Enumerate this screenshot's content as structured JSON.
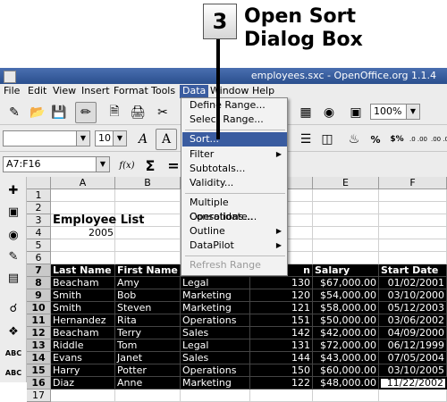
{
  "callout": {
    "number": "3",
    "line1": "Open Sort",
    "line2": "Dialog Box"
  },
  "window": {
    "title": "employees.sxc - OpenOffice.org 1.1.4"
  },
  "menubar": [
    "File",
    "Edit",
    "View",
    "Insert",
    "Format",
    "Tools",
    "Data",
    "Window",
    "Help"
  ],
  "toolbar": {
    "zoom": "100%",
    "font_size": "10",
    "italic": "A",
    "outline": "A",
    "percent": "%",
    "currency": "$%",
    "decimal_add": ".0 .00",
    "decimal_del": ".00 .0"
  },
  "formula_bar": {
    "cell_ref": "A7:F16",
    "fx": "f(x)",
    "sum": "Σ",
    "equals": "="
  },
  "data_menu": {
    "items": [
      {
        "label": "Define Range..."
      },
      {
        "label": "Select Range..."
      },
      {
        "label": "Sort..."
      },
      {
        "label": "Filter"
      },
      {
        "label": "Subtotals..."
      },
      {
        "label": "Validity..."
      },
      {
        "label": "Multiple Operations..."
      },
      {
        "label": "Consolidate..."
      },
      {
        "label": "Outline"
      },
      {
        "label": "DataPilot"
      },
      {
        "label": "Refresh Range"
      }
    ]
  },
  "sheet": {
    "columns": [
      "A",
      "B",
      "C",
      "D",
      "E",
      "F"
    ],
    "rows": [
      "1",
      "2",
      "3",
      "4",
      "5",
      "6",
      "7",
      "8",
      "9",
      "10",
      "11",
      "12",
      "13",
      "14",
      "15",
      "16",
      "17"
    ],
    "title": "Employee List",
    "year": "2005",
    "headers": [
      "Last Name",
      "First Name",
      "",
      "n",
      "Salary",
      "Start Date"
    ],
    "data": [
      [
        "Beacham",
        "Amy",
        "Legal",
        "130",
        "$67,000.00",
        "01/02/2001"
      ],
      [
        "Smith",
        "Bob",
        "Marketing",
        "120",
        "$54,000.00",
        "03/10/2000"
      ],
      [
        "Smith",
        "Steven",
        "Marketing",
        "121",
        "$58,000.00",
        "05/12/2003"
      ],
      [
        "Hernandez",
        "Rita",
        "Operations",
        "151",
        "$50,000.00",
        "03/06/2002"
      ],
      [
        "Beacham",
        "Terry",
        "Sales",
        "142",
        "$42,000.00",
        "04/09/2000"
      ],
      [
        "Riddle",
        "Tom",
        "Legal",
        "131",
        "$72,000.00",
        "06/12/1999"
      ],
      [
        "Evans",
        "Janet",
        "Sales",
        "144",
        "$43,000.00",
        "07/05/2004"
      ],
      [
        "Harry",
        "Potter",
        "Operations",
        "150",
        "$60,000.00",
        "03/10/2005"
      ],
      [
        "Diaz",
        "Anne",
        "Marketing",
        "122",
        "$48,000.00",
        "11/22/2002"
      ]
    ]
  }
}
